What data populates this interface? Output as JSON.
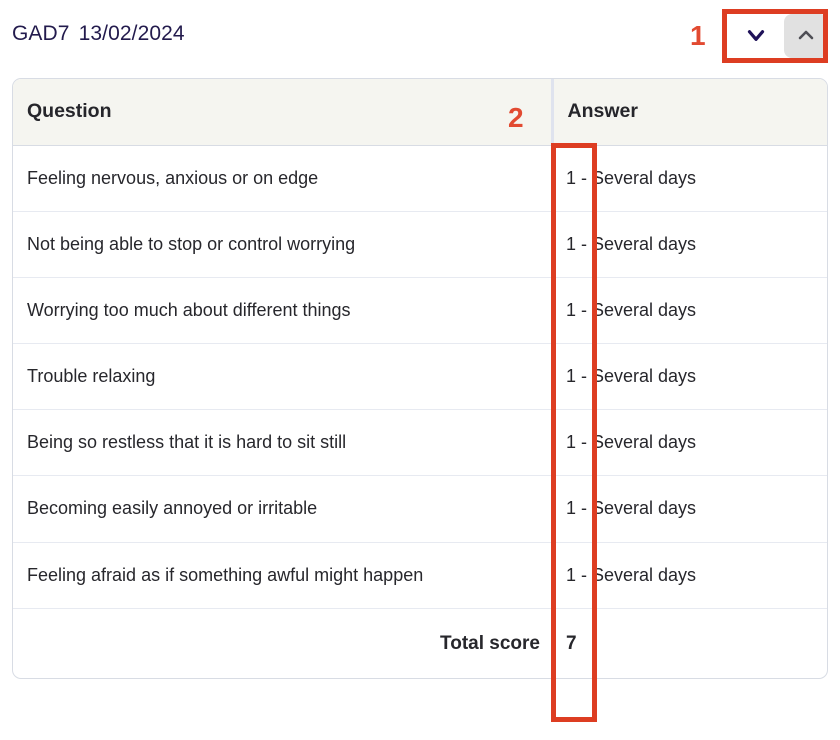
{
  "header": {
    "assessment_code": "GAD7",
    "date": "13/02/2024",
    "collapse_button_icon": "chevron-down-icon",
    "expand_button_icon": "chevron-up-icon"
  },
  "table": {
    "columns": [
      "Question",
      "Answer"
    ],
    "rows": [
      {
        "question": "Feeling nervous, anxious or on edge",
        "answer": "1 - Several days"
      },
      {
        "question": "Not being able to stop or control worrying",
        "answer": "1 - Several days"
      },
      {
        "question": "Worrying too much about different things",
        "answer": "1 - Several days"
      },
      {
        "question": "Trouble relaxing",
        "answer": "1 - Several days"
      },
      {
        "question": "Being so restless that it is hard to sit still",
        "answer": "1 - Several days"
      },
      {
        "question": "Becoming easily annoyed or irritable",
        "answer": "1 - Several days"
      },
      {
        "question": "Feeling afraid as if something awful might happen",
        "answer": "1 - Several days"
      }
    ],
    "total_label": "Total score",
    "total_value": "7"
  },
  "annotations": [
    {
      "label": "1",
      "target": "collapse-expand-controls"
    },
    {
      "label": "2",
      "target": "answer-score-column"
    }
  ],
  "colors": {
    "annotation": "#dd3d22",
    "annotation_label": "#e24a31",
    "title": "#231b4d",
    "header_background": "#f5f5f0",
    "border": "#d8dce4",
    "row_divider": "#e7eaf1",
    "button_background": "#e1e1e1"
  }
}
